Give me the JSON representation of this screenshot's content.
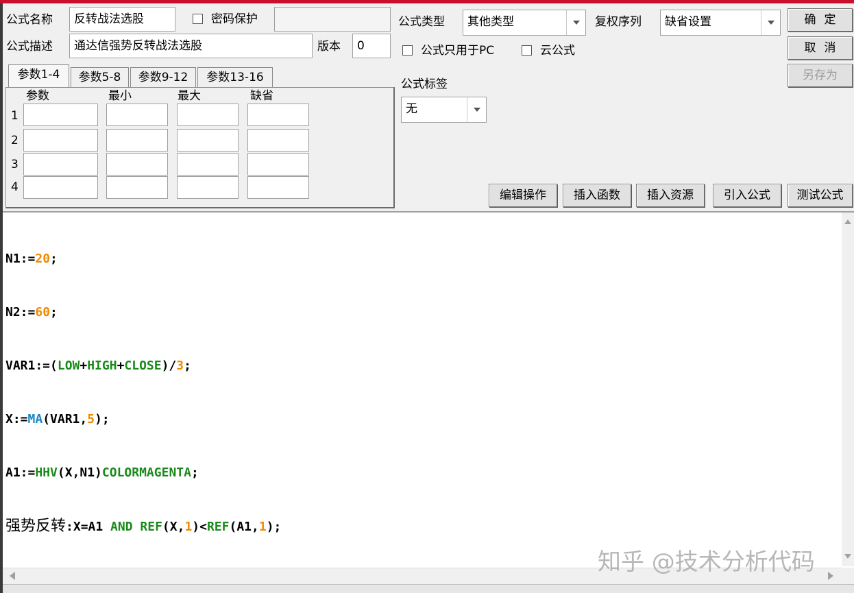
{
  "header": {
    "name_label": "公式名称",
    "name_value": "反转战法选股",
    "password_label": "密码保护",
    "password_checked": false,
    "desc_label": "公式描述",
    "desc_value": "通达信强势反转战法选股",
    "version_label": "版本",
    "version_value": "0"
  },
  "right_panel": {
    "type_label": "公式类型",
    "type_value": "其他类型",
    "rights_label": "复权序列",
    "rights_value": "缺省设置",
    "pc_only_label": "公式只用于PC",
    "pc_only_checked": false,
    "cloud_label": "云公式",
    "cloud_checked": false,
    "tag_label": "公式标签",
    "tag_value": "无"
  },
  "buttons": {
    "ok": "确定",
    "cancel": "取消",
    "save_as": "另存为",
    "edit_ops": "编辑操作",
    "insert_func": "插入函数",
    "insert_res": "插入资源",
    "import_formula": "引入公式",
    "test_formula": "测试公式"
  },
  "params": {
    "tabs": [
      "参数1-4",
      "参数5-8",
      "参数9-12",
      "参数13-16"
    ],
    "active_tab": 0,
    "columns": [
      "参数",
      "最小",
      "最大",
      "缺省"
    ],
    "rows": [
      "1",
      "2",
      "3",
      "4"
    ]
  },
  "code": {
    "l1": [
      "N1:=",
      "20",
      ";"
    ],
    "l2": [
      "N2:=",
      "60",
      ";"
    ],
    "l3": [
      "VAR1:=(",
      "LOW",
      "+",
      "HIGH",
      "+",
      "CLOSE",
      ")/",
      "3",
      ";"
    ],
    "l4": [
      "X:=",
      "MA",
      "(VAR1,",
      "5",
      ");"
    ],
    "l5": [
      "A1:=",
      "HHV",
      "(X,N1)",
      "COLORMAGENTA",
      ";"
    ],
    "l6": [
      "强势反转",
      ":X=A1 ",
      "AND",
      " ",
      "REF",
      "(X,",
      "1",
      ")<",
      "REF",
      "(A1,",
      "1",
      ");"
    ]
  },
  "watermark": "知乎 @技术分析代码",
  "colors": {
    "title_bar": "#c8102e",
    "number": "#f08a00",
    "function": "#1a8a1a",
    "ma_function": "#1a86c8"
  }
}
